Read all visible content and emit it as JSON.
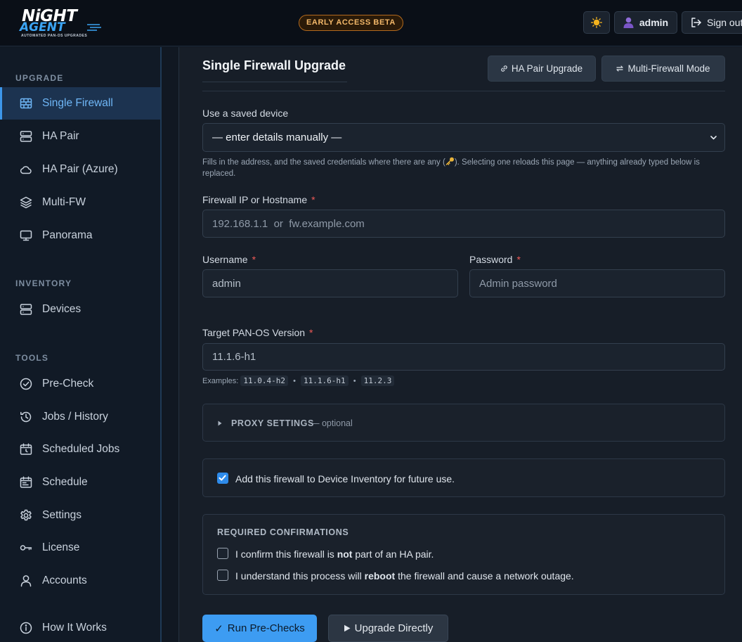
{
  "header": {
    "logo": {
      "line1": "NiGHT",
      "line2": "AGENT",
      "tagline": "AUTOMATED PAN-OS UPGRADES"
    },
    "beta_badge": "EARLY ACCESS BETA",
    "user_label": "admin",
    "sign_out_label": "Sign out"
  },
  "sidebar": {
    "sections": [
      {
        "label": "UPGRADE"
      },
      {
        "label": "INVENTORY"
      },
      {
        "label": "TOOLS"
      }
    ],
    "items": [
      {
        "label": "Single Firewall",
        "icon": "firewall-icon",
        "active": true
      },
      {
        "label": "HA Pair",
        "icon": "server-stack-icon"
      },
      {
        "label": "HA Pair (Azure)",
        "icon": "cloud-icon"
      },
      {
        "label": "Multi-FW",
        "icon": "layers-icon"
      },
      {
        "label": "Panorama",
        "icon": "monitor-icon"
      },
      {
        "label": "Devices",
        "icon": "server-icon"
      },
      {
        "label": "Pre-Check",
        "icon": "check-circle-icon"
      },
      {
        "label": "Jobs / History",
        "icon": "history-icon"
      },
      {
        "label": "Scheduled Jobs",
        "icon": "calendar-clock-icon"
      },
      {
        "label": "Schedule",
        "icon": "calendar-icon"
      },
      {
        "label": "Settings",
        "icon": "gear-icon"
      },
      {
        "label": "License",
        "icon": "key-icon"
      },
      {
        "label": "Accounts",
        "icon": "user-icon"
      },
      {
        "label": "How It Works",
        "icon": "info-icon"
      }
    ]
  },
  "main": {
    "title": "Single Firewall Upgrade",
    "ha_pair_button": "HA Pair Upgrade",
    "multi_fw_button": "Multi-Firewall Mode",
    "saved_device": {
      "label": "Use a saved device",
      "selected": "— enter details manually —",
      "help_part1": "Fills in the address, and the saved credentials where there are any (",
      "help_part2": "). Selecting one reloads this page — anything already typed below is replaced."
    },
    "firewall_ip": {
      "label": "Firewall IP or Hostname",
      "placeholder": "192.168.1.1  or  fw.example.com"
    },
    "username": {
      "label": "Username",
      "value": "admin"
    },
    "password": {
      "label": "Password",
      "placeholder": "Admin password"
    },
    "target_version": {
      "label": "Target PAN-OS Version",
      "value": "11.1.6-h1",
      "examples_label": "Examples:",
      "examples": [
        "11.0.4-h2",
        "11.1.6-h1",
        "11.2.3"
      ]
    },
    "proxy": {
      "label": "PROXY SETTINGS",
      "suffix": "— optional"
    },
    "inventory_checkbox": {
      "label": "Add this firewall to Device Inventory for future use.",
      "checked": true
    },
    "confirmations": {
      "heading": "REQUIRED CONFIRMATIONS",
      "c1_before": "I confirm this firewall is ",
      "c1_bold": "not",
      "c1_after": " part of an HA pair.",
      "c2_before": "I understand this process will ",
      "c2_bold": "reboot",
      "c2_after": " the firewall and cause a network outage."
    },
    "run_prechecks_button": "Run Pre-Checks",
    "upgrade_directly_button": "Upgrade Directly"
  }
}
